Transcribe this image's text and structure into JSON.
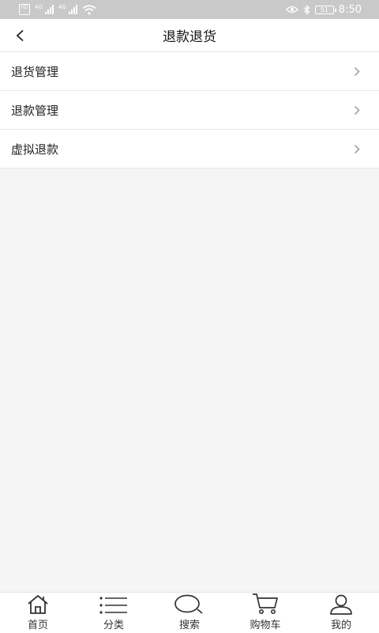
{
  "status_bar": {
    "sim1": "HD",
    "net1": "4G",
    "sim2": "HD",
    "net2": "4G",
    "battery": "51",
    "time": "8:50"
  },
  "header": {
    "title": "退款退货"
  },
  "menu": {
    "items": [
      {
        "label": "退货管理"
      },
      {
        "label": "退款管理"
      },
      {
        "label": "虚拟退款"
      }
    ]
  },
  "tab_bar": {
    "tabs": [
      {
        "label": "首页",
        "icon": "home-icon"
      },
      {
        "label": "分类",
        "icon": "list-icon"
      },
      {
        "label": "搜索",
        "icon": "search-icon"
      },
      {
        "label": "购物车",
        "icon": "cart-icon"
      },
      {
        "label": "我的",
        "icon": "user-icon"
      }
    ]
  }
}
